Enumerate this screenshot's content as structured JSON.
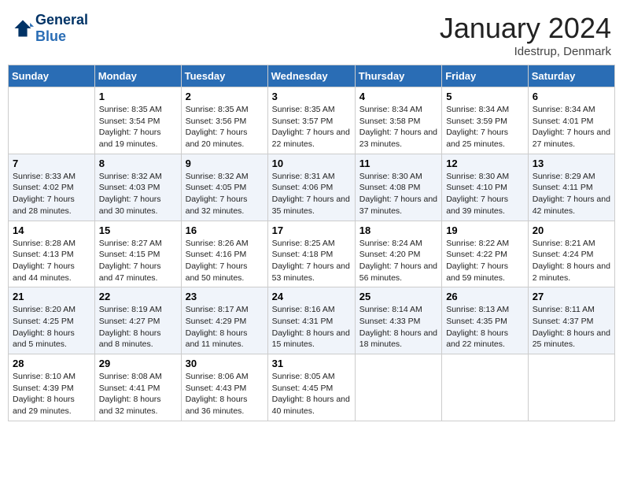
{
  "header": {
    "logo_line1": "General",
    "logo_line2": "Blue",
    "month_title": "January 2024",
    "location": "Idestrup, Denmark"
  },
  "weekdays": [
    "Sunday",
    "Monday",
    "Tuesday",
    "Wednesday",
    "Thursday",
    "Friday",
    "Saturday"
  ],
  "weeks": [
    [
      {
        "day": "",
        "sunrise": "",
        "sunset": "",
        "daylight": ""
      },
      {
        "day": "1",
        "sunrise": "Sunrise: 8:35 AM",
        "sunset": "Sunset: 3:54 PM",
        "daylight": "Daylight: 7 hours and 19 minutes."
      },
      {
        "day": "2",
        "sunrise": "Sunrise: 8:35 AM",
        "sunset": "Sunset: 3:56 PM",
        "daylight": "Daylight: 7 hours and 20 minutes."
      },
      {
        "day": "3",
        "sunrise": "Sunrise: 8:35 AM",
        "sunset": "Sunset: 3:57 PM",
        "daylight": "Daylight: 7 hours and 22 minutes."
      },
      {
        "day": "4",
        "sunrise": "Sunrise: 8:34 AM",
        "sunset": "Sunset: 3:58 PM",
        "daylight": "Daylight: 7 hours and 23 minutes."
      },
      {
        "day": "5",
        "sunrise": "Sunrise: 8:34 AM",
        "sunset": "Sunset: 3:59 PM",
        "daylight": "Daylight: 7 hours and 25 minutes."
      },
      {
        "day": "6",
        "sunrise": "Sunrise: 8:34 AM",
        "sunset": "Sunset: 4:01 PM",
        "daylight": "Daylight: 7 hours and 27 minutes."
      }
    ],
    [
      {
        "day": "7",
        "sunrise": "Sunrise: 8:33 AM",
        "sunset": "Sunset: 4:02 PM",
        "daylight": "Daylight: 7 hours and 28 minutes."
      },
      {
        "day": "8",
        "sunrise": "Sunrise: 8:32 AM",
        "sunset": "Sunset: 4:03 PM",
        "daylight": "Daylight: 7 hours and 30 minutes."
      },
      {
        "day": "9",
        "sunrise": "Sunrise: 8:32 AM",
        "sunset": "Sunset: 4:05 PM",
        "daylight": "Daylight: 7 hours and 32 minutes."
      },
      {
        "day": "10",
        "sunrise": "Sunrise: 8:31 AM",
        "sunset": "Sunset: 4:06 PM",
        "daylight": "Daylight: 7 hours and 35 minutes."
      },
      {
        "day": "11",
        "sunrise": "Sunrise: 8:30 AM",
        "sunset": "Sunset: 4:08 PM",
        "daylight": "Daylight: 7 hours and 37 minutes."
      },
      {
        "day": "12",
        "sunrise": "Sunrise: 8:30 AM",
        "sunset": "Sunset: 4:10 PM",
        "daylight": "Daylight: 7 hours and 39 minutes."
      },
      {
        "day": "13",
        "sunrise": "Sunrise: 8:29 AM",
        "sunset": "Sunset: 4:11 PM",
        "daylight": "Daylight: 7 hours and 42 minutes."
      }
    ],
    [
      {
        "day": "14",
        "sunrise": "Sunrise: 8:28 AM",
        "sunset": "Sunset: 4:13 PM",
        "daylight": "Daylight: 7 hours and 44 minutes."
      },
      {
        "day": "15",
        "sunrise": "Sunrise: 8:27 AM",
        "sunset": "Sunset: 4:15 PM",
        "daylight": "Daylight: 7 hours and 47 minutes."
      },
      {
        "day": "16",
        "sunrise": "Sunrise: 8:26 AM",
        "sunset": "Sunset: 4:16 PM",
        "daylight": "Daylight: 7 hours and 50 minutes."
      },
      {
        "day": "17",
        "sunrise": "Sunrise: 8:25 AM",
        "sunset": "Sunset: 4:18 PM",
        "daylight": "Daylight: 7 hours and 53 minutes."
      },
      {
        "day": "18",
        "sunrise": "Sunrise: 8:24 AM",
        "sunset": "Sunset: 4:20 PM",
        "daylight": "Daylight: 7 hours and 56 minutes."
      },
      {
        "day": "19",
        "sunrise": "Sunrise: 8:22 AM",
        "sunset": "Sunset: 4:22 PM",
        "daylight": "Daylight: 7 hours and 59 minutes."
      },
      {
        "day": "20",
        "sunrise": "Sunrise: 8:21 AM",
        "sunset": "Sunset: 4:24 PM",
        "daylight": "Daylight: 8 hours and 2 minutes."
      }
    ],
    [
      {
        "day": "21",
        "sunrise": "Sunrise: 8:20 AM",
        "sunset": "Sunset: 4:25 PM",
        "daylight": "Daylight: 8 hours and 5 minutes."
      },
      {
        "day": "22",
        "sunrise": "Sunrise: 8:19 AM",
        "sunset": "Sunset: 4:27 PM",
        "daylight": "Daylight: 8 hours and 8 minutes."
      },
      {
        "day": "23",
        "sunrise": "Sunrise: 8:17 AM",
        "sunset": "Sunset: 4:29 PM",
        "daylight": "Daylight: 8 hours and 11 minutes."
      },
      {
        "day": "24",
        "sunrise": "Sunrise: 8:16 AM",
        "sunset": "Sunset: 4:31 PM",
        "daylight": "Daylight: 8 hours and 15 minutes."
      },
      {
        "day": "25",
        "sunrise": "Sunrise: 8:14 AM",
        "sunset": "Sunset: 4:33 PM",
        "daylight": "Daylight: 8 hours and 18 minutes."
      },
      {
        "day": "26",
        "sunrise": "Sunrise: 8:13 AM",
        "sunset": "Sunset: 4:35 PM",
        "daylight": "Daylight: 8 hours and 22 minutes."
      },
      {
        "day": "27",
        "sunrise": "Sunrise: 8:11 AM",
        "sunset": "Sunset: 4:37 PM",
        "daylight": "Daylight: 8 hours and 25 minutes."
      }
    ],
    [
      {
        "day": "28",
        "sunrise": "Sunrise: 8:10 AM",
        "sunset": "Sunset: 4:39 PM",
        "daylight": "Daylight: 8 hours and 29 minutes."
      },
      {
        "day": "29",
        "sunrise": "Sunrise: 8:08 AM",
        "sunset": "Sunset: 4:41 PM",
        "daylight": "Daylight: 8 hours and 32 minutes."
      },
      {
        "day": "30",
        "sunrise": "Sunrise: 8:06 AM",
        "sunset": "Sunset: 4:43 PM",
        "daylight": "Daylight: 8 hours and 36 minutes."
      },
      {
        "day": "31",
        "sunrise": "Sunrise: 8:05 AM",
        "sunset": "Sunset: 4:45 PM",
        "daylight": "Daylight: 8 hours and 40 minutes."
      },
      {
        "day": "",
        "sunrise": "",
        "sunset": "",
        "daylight": ""
      },
      {
        "day": "",
        "sunrise": "",
        "sunset": "",
        "daylight": ""
      },
      {
        "day": "",
        "sunrise": "",
        "sunset": "",
        "daylight": ""
      }
    ]
  ]
}
